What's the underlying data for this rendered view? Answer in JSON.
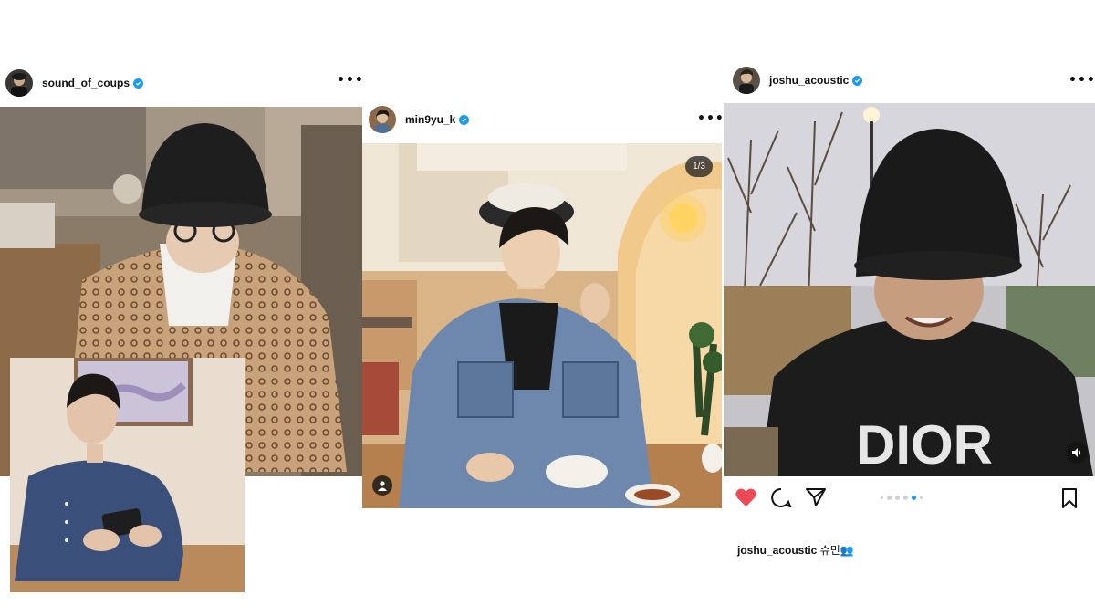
{
  "posts": [
    {
      "username": "sound_of_coups",
      "verified": true,
      "more_icon": "more-horizontal-icon"
    },
    {
      "username": "min9yu_k",
      "verified": true,
      "more_icon": "more-horizontal-icon",
      "carousel_counter": "1/3",
      "tag_icon": "user-tag-icon"
    },
    {
      "username": "joshu_acoustic",
      "verified": true,
      "more_icon": "more-horizontal-icon",
      "sound_icon": "volume-icon",
      "liked": true,
      "carousel_active_index": 4,
      "caption_user": "joshu_acoustic",
      "caption_text": "슈민👥"
    }
  ],
  "colors": {
    "like_red": "#ed4956",
    "verified_blue": "#1d9bf0",
    "dot_active": "#1d9bf0"
  }
}
